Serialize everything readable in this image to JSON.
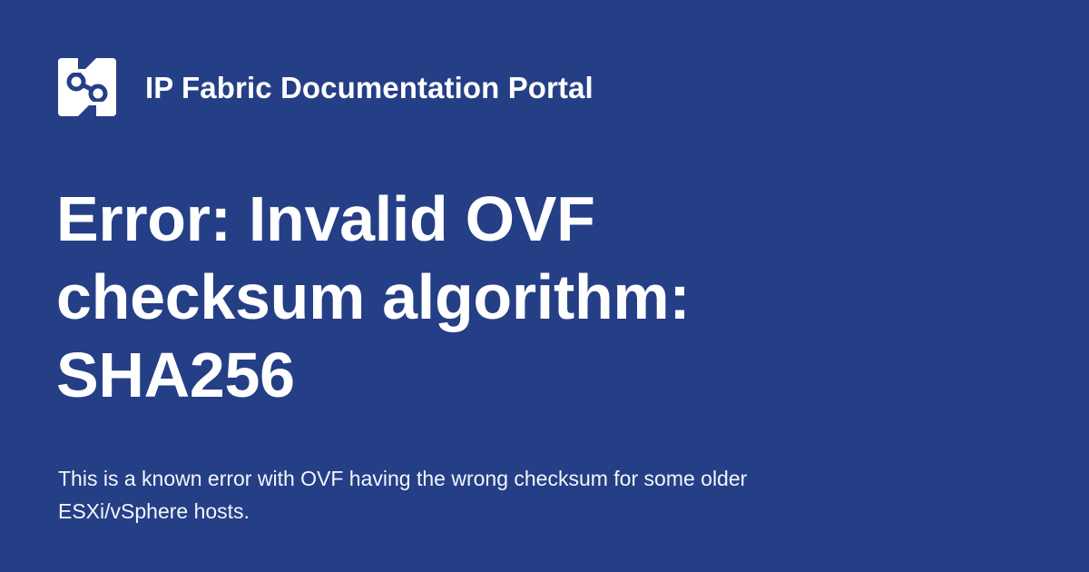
{
  "header": {
    "logo_icon": "ip-fabric-logo-icon",
    "site_name": "IP Fabric Documentation Portal"
  },
  "page": {
    "title": "Error: Invalid OVF checksum algorithm: SHA256",
    "description": "This is a known error with OVF having the wrong checksum for some older ESXi/vSphere hosts."
  },
  "colors": {
    "background": "#253f86",
    "text": "#ffffff",
    "logo_background": "#ffffff"
  }
}
